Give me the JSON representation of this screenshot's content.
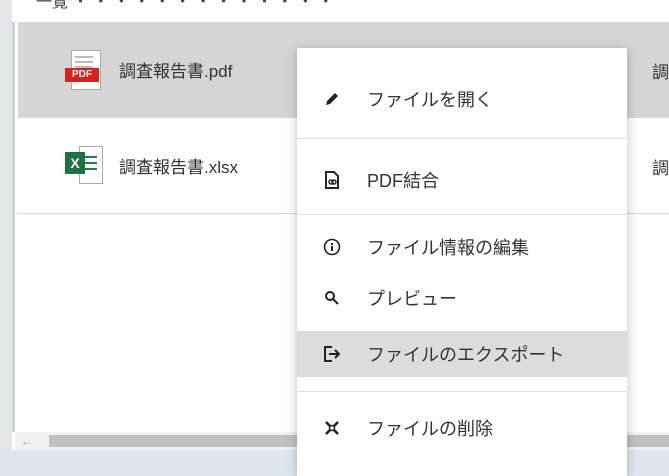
{
  "top_partial_text": "一覧 ・ ・ ・ ・ ・ ・ ・ ・ ・ ・ ・ ・ ・",
  "files": [
    {
      "name": "調査報告書.pdf",
      "type": "pdf",
      "badge": "PDF",
      "right_stub": "調"
    },
    {
      "name": "調査報告書.xlsx",
      "type": "xlsx",
      "badge": "X",
      "right_stub": "調"
    }
  ],
  "scrollbar": {
    "left_arrow": "←"
  },
  "context_menu": {
    "items": [
      {
        "label": "ファイルを開く",
        "icon": "pencil-icon"
      },
      {
        "label": "PDF結合",
        "icon": "pdf-merge-icon"
      },
      {
        "label": "ファイル情報の編集",
        "icon": "info-icon"
      },
      {
        "label": "プレビュー",
        "icon": "search-icon"
      },
      {
        "label": "ファイルのエクスポート",
        "icon": "export-icon"
      },
      {
        "label": "ファイルの削除",
        "icon": "delete-icon"
      }
    ],
    "highlighted": "ファイルのエクスポート"
  }
}
